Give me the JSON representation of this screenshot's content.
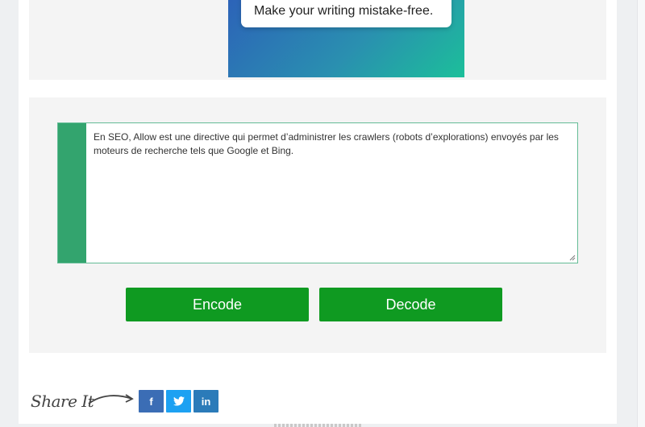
{
  "ad": {
    "tagline": "Make your writing mistake-free."
  },
  "tool": {
    "input_text": "En SEO, Allow est une directive qui permet d’administrer les crawlers (robots d’explorations) envoyés par les moteurs de recherche tels que Google et Bing.",
    "encode_label": "Encode",
    "decode_label": "Decode"
  },
  "share": {
    "label": "Share It",
    "buttons": [
      {
        "icon": "facebook-icon",
        "glyph": "f",
        "color": "#3b6db5"
      },
      {
        "icon": "twitter-icon",
        "glyph": "🐦",
        "color": "#1da1f2"
      },
      {
        "icon": "linkedin-icon",
        "glyph": "in",
        "color": "#2b7bb9"
      }
    ]
  },
  "colors": {
    "accent": "#33a46e",
    "button": "#0f9a21"
  }
}
